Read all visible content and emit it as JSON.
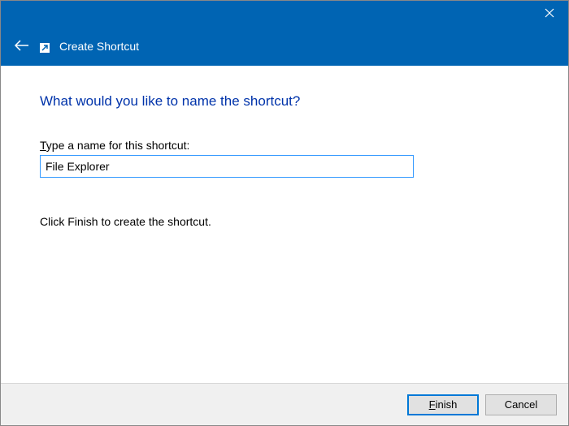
{
  "titlebar": {
    "title": "Create Shortcut"
  },
  "content": {
    "heading": "What would you like to name the shortcut?",
    "field_label_prefix": "T",
    "field_label_rest": "ype a name for this shortcut:",
    "input_value": "File Explorer",
    "instruction": "Click Finish to create the shortcut."
  },
  "footer": {
    "finish_ak": "F",
    "finish_rest": "inish",
    "cancel": "Cancel"
  }
}
